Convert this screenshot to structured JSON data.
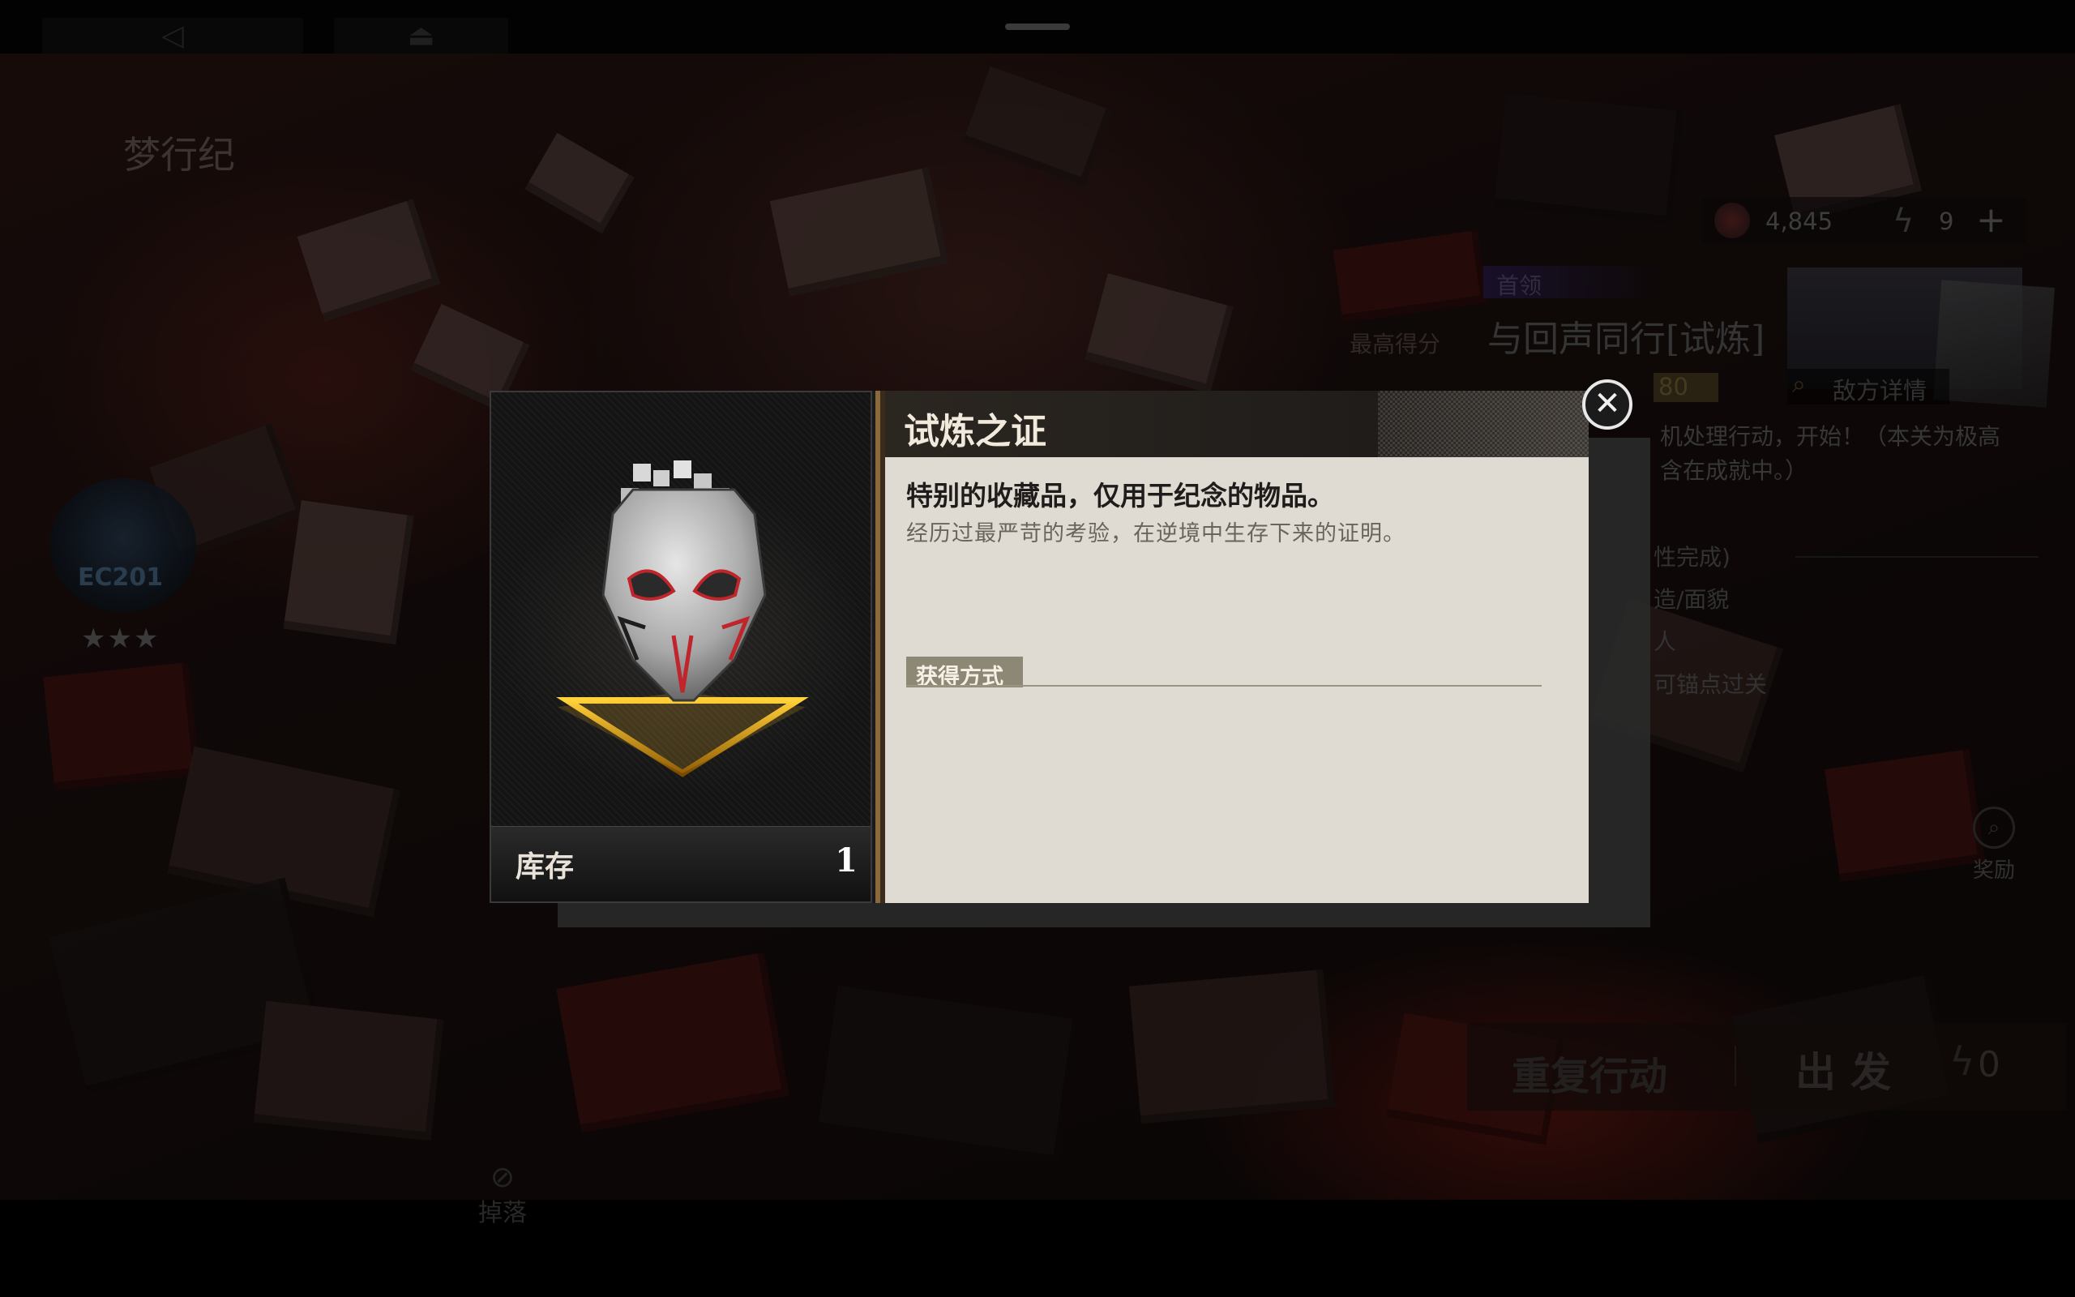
{
  "scene": {
    "game_title": "梦行纪",
    "stage_code": "EC201",
    "stars": "★★★",
    "resources": {
      "coin": "4,845",
      "stamina": "9"
    },
    "boss_tag": "首领",
    "stage_name": "与回声同行[试炼]",
    "best_score_label": "最高得分",
    "best_score_value": "80",
    "enemy_details_label": "敌方详情",
    "bg_description": "机处理行动，开始！（本关为极高\n含在成就中。）",
    "objectives": [
      "性完成)",
      "造/面貌",
      "人",
      "可锚点过关"
    ],
    "reward_label": "奖励",
    "repeat_label": "重复行动",
    "depart_label": "出发",
    "depart_cost": "0",
    "drop_label": "掉落"
  },
  "item_modal": {
    "title": "试炼之证",
    "stock_label": "库存",
    "stock_count": "1",
    "description_main": "特别的收藏品，仅用于纪念的物品。",
    "description_sub": "经历过最严苛的考验，在逆境中生存下来的证明。",
    "source_label": "获得方式"
  },
  "icons": {
    "back": "back-triangle-icon",
    "home": "home-icon",
    "close": "close-icon",
    "stamina": "lightning-icon",
    "add": "plus-icon",
    "search": "magnifier-icon",
    "drop": "eye-slash-icon"
  },
  "colors": {
    "accent_gold": "#8a6a3c",
    "modal_body": "#e0dbd2",
    "source_tag": "#8d8775"
  }
}
